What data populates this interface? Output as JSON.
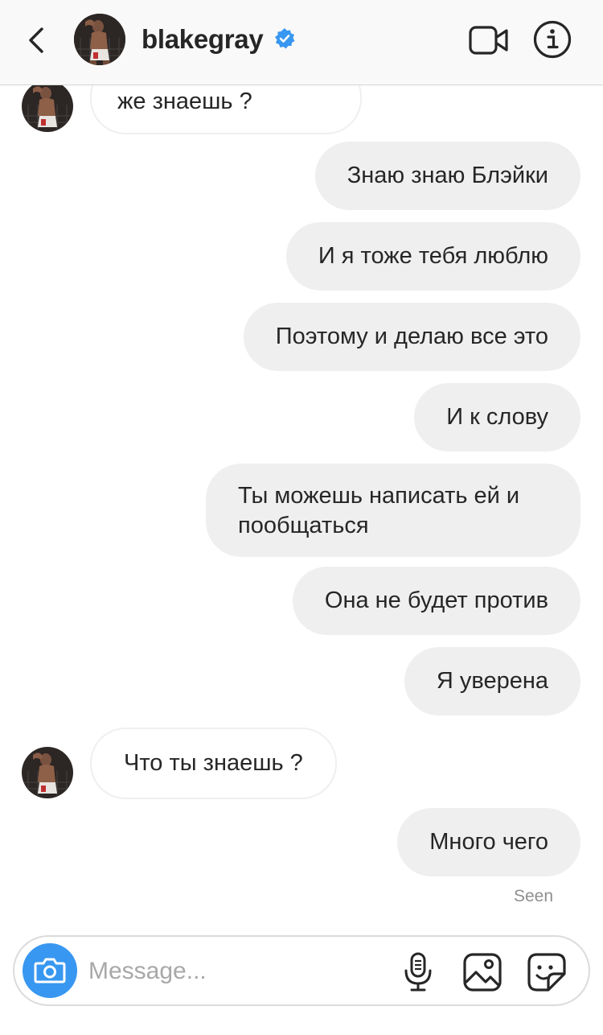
{
  "header": {
    "username": "blakegray",
    "verified": true,
    "icons": {
      "back": "chevron-left-icon",
      "verified": "verified-badge-icon",
      "video": "video-camera-icon",
      "info": "info-icon"
    },
    "accent_color": "#3897f0"
  },
  "messages": [
    {
      "direction": "in",
      "text": "же знаешь ?"
    },
    {
      "direction": "out",
      "text": "Знаю знаю Блэйки"
    },
    {
      "direction": "out",
      "text": "И я тоже тебя люблю"
    },
    {
      "direction": "out",
      "text": "Поэтому и делаю все это"
    },
    {
      "direction": "out",
      "text": "И к слову"
    },
    {
      "direction": "out",
      "text": "Ты можешь написать ей и пообщаться"
    },
    {
      "direction": "out",
      "text": "Она не будет против"
    },
    {
      "direction": "out",
      "text": "Я уверена"
    },
    {
      "direction": "in",
      "text": "Что ты знаешь ?"
    },
    {
      "direction": "out",
      "text": "Много чего"
    }
  ],
  "status": {
    "seen": "Seen"
  },
  "composer": {
    "placeholder": "Message...",
    "icons": {
      "camera": "camera-icon",
      "mic": "microphone-icon",
      "gallery": "gallery-icon",
      "sticker": "sticker-icon"
    }
  },
  "colors": {
    "outgoing_bubble": "#efefef",
    "incoming_border": "#efefef",
    "seen_text": "#8e8e8e"
  }
}
